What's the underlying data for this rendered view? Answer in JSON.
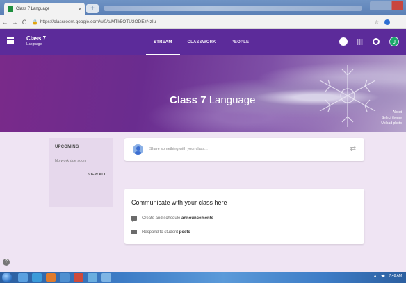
{
  "browser": {
    "tab_title": "Class 7 Language",
    "tab_close": "×",
    "new_tab": "+",
    "url": "https://classroom.google.com/u/0/c/MTk5OTU2ODEzNzIu",
    "back": "←",
    "forward": "→",
    "reload": "C",
    "star": "☆",
    "menu": "⋮"
  },
  "header": {
    "class_name": "Class 7",
    "section": "Language",
    "tabs": [
      {
        "label": "STREAM",
        "active": true
      },
      {
        "label": "CLASSWORK",
        "active": false
      },
      {
        "label": "PEOPLE",
        "active": false
      }
    ],
    "avatar_letter": "J"
  },
  "banner": {
    "title_bold": "Class 7",
    "title_rest": "Language",
    "links": [
      "About",
      "Select theme",
      "Upload photo"
    ]
  },
  "upcoming": {
    "heading": "UPCOMING",
    "empty_text": "No work due soon",
    "view_all": "VIEW ALL"
  },
  "share": {
    "placeholder": "Share something with your class..."
  },
  "info": {
    "title": "Communicate with your class here",
    "rows": [
      {
        "prefix": "Create and schedule ",
        "bold": "announcements"
      },
      {
        "prefix": "Respond to student ",
        "bold": "posts"
      }
    ]
  },
  "help_label": "?",
  "taskbar": {
    "time": "7:48 AM"
  },
  "colors": {
    "header": "#5c2b9a",
    "page_bg": "#efe4f3",
    "avatar": "#1aa66a",
    "taskbar": "#3d7cc6"
  }
}
